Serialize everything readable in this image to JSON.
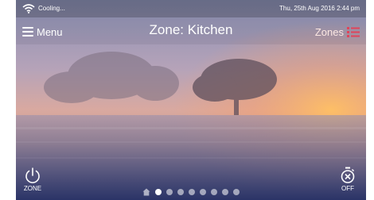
{
  "status": {
    "text": "Cooling...",
    "datetime": "Thu, 25th Aug 2016  2:44 pm"
  },
  "header": {
    "menu_label": "Menu",
    "zone_title": "Zone: Kitchen",
    "zones_label": "Zones"
  },
  "footer": {
    "power_label": "ZONE",
    "timer_label": "OFF"
  },
  "pager": {
    "total_dots": 8,
    "active_index": 0
  },
  "icons": [
    "wifi-icon",
    "menu-icon",
    "list-icon",
    "power-icon",
    "timer-off-icon",
    "home-icon"
  ],
  "colors": {
    "accent": "#e0445a",
    "text": "#ffffff"
  }
}
